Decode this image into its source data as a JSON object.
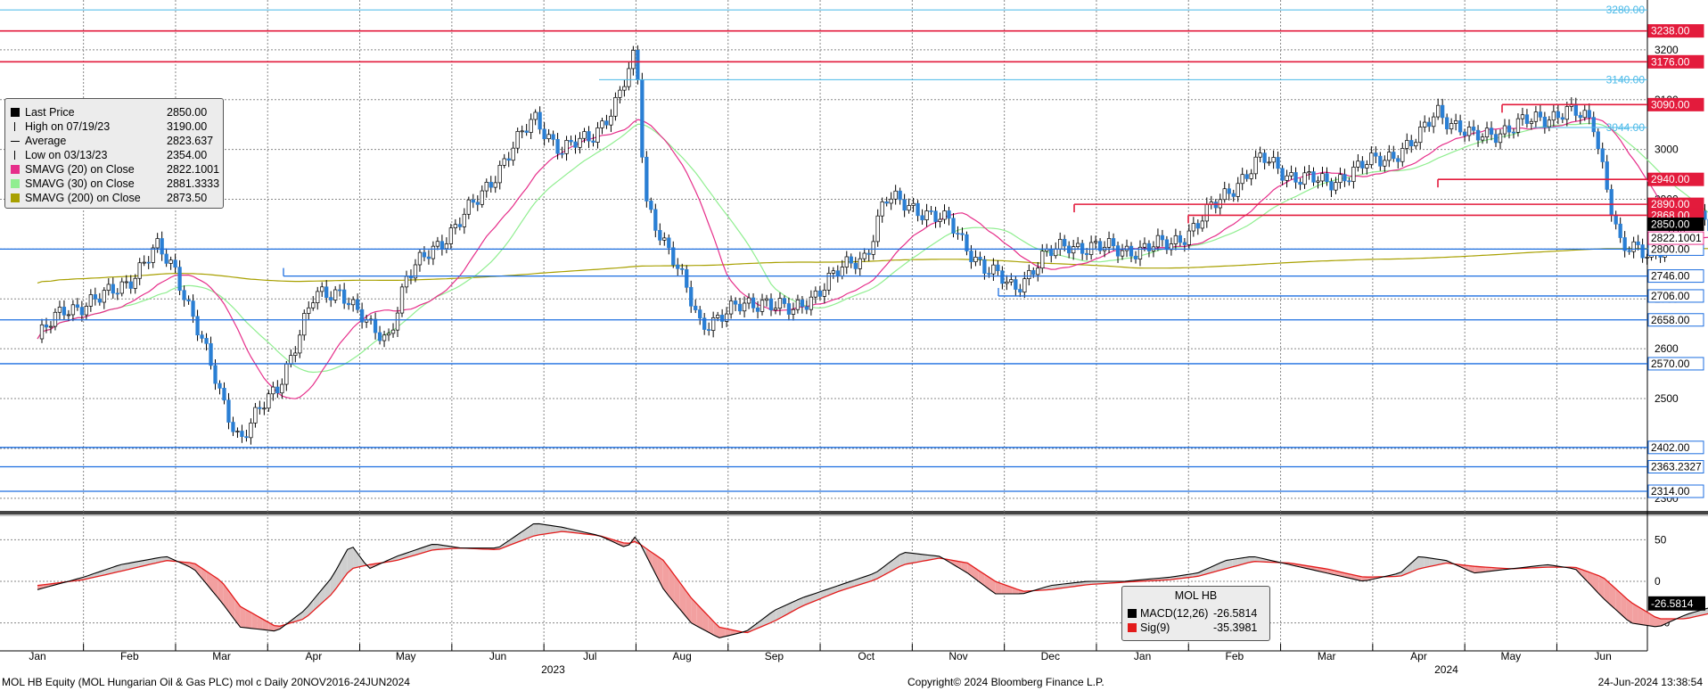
{
  "chart_data": [
    {
      "type": "candlestick",
      "title": "",
      "ylim": [
        2280,
        3300
      ],
      "y_ticks": [
        2300,
        2400,
        2500,
        2600,
        2700,
        2800,
        2900,
        3000,
        3100,
        3200
      ],
      "grid": true,
      "x_labels": [
        "Jan",
        "Feb",
        "Mar",
        "Apr",
        "May",
        "Jun",
        "Jul",
        "Aug",
        "Sep",
        "Oct",
        "Nov",
        "Dec",
        "Jan",
        "Feb",
        "Mar",
        "Apr",
        "May",
        "Jun"
      ],
      "year_labels": [
        "2023",
        "2024"
      ],
      "price_path": [
        [
          0,
          2620
        ],
        [
          0.3,
          2680
        ],
        [
          0.7,
          2700
        ],
        [
          1.0,
          2740
        ],
        [
          1.3,
          2800
        ],
        [
          1.5,
          2760
        ],
        [
          1.7,
          2660
        ],
        [
          2.0,
          2500
        ],
        [
          2.2,
          2420
        ],
        [
          2.6,
          2520
        ],
        [
          3.0,
          2700
        ],
        [
          3.3,
          2720
        ],
        [
          3.6,
          2640
        ],
        [
          3.8,
          2620
        ],
        [
          4.0,
          2740
        ],
        [
          4.4,
          2820
        ],
        [
          4.8,
          2900
        ],
        [
          5.1,
          2990
        ],
        [
          5.4,
          3060
        ],
        [
          5.7,
          3000
        ],
        [
          6.0,
          3020
        ],
        [
          6.3,
          3100
        ],
        [
          6.5,
          3190
        ],
        [
          6.6,
          2900
        ],
        [
          6.9,
          2780
        ],
        [
          7.2,
          2650
        ],
        [
          7.6,
          2680
        ],
        [
          7.9,
          2700
        ],
        [
          8.2,
          2670
        ],
        [
          8.6,
          2740
        ],
        [
          9.0,
          2790
        ],
        [
          9.2,
          2900
        ],
        [
          9.6,
          2880
        ],
        [
          9.9,
          2850
        ],
        [
          10.3,
          2760
        ],
        [
          10.6,
          2720
        ],
        [
          10.9,
          2780
        ],
        [
          11.2,
          2810
        ],
        [
          11.6,
          2800
        ],
        [
          12.0,
          2800
        ],
        [
          12.3,
          2810
        ],
        [
          12.6,
          2850
        ],
        [
          13.0,
          2930
        ],
        [
          13.3,
          2980
        ],
        [
          13.6,
          2950
        ],
        [
          14.0,
          2930
        ],
        [
          14.3,
          2960
        ],
        [
          14.6,
          2980
        ],
        [
          15.0,
          3020
        ],
        [
          15.2,
          3080
        ],
        [
          15.6,
          3020
        ],
        [
          15.9,
          3040
        ],
        [
          16.3,
          3060
        ],
        [
          16.6,
          3080
        ],
        [
          16.9,
          3050
        ],
        [
          17.2,
          2800
        ],
        [
          17.5,
          2790
        ],
        [
          17.8,
          2830
        ],
        [
          18.0,
          2870
        ],
        [
          18.3,
          2850
        ]
      ],
      "legend": [
        {
          "label": "Last Price",
          "value": "2850.00",
          "color": "#000000",
          "marker": "box"
        },
        {
          "label": "High on 07/19/23",
          "value": "3190.00",
          "color": "#000000",
          "marker": "high"
        },
        {
          "label": "Average",
          "value": "2823.637",
          "color": "#000000",
          "marker": "avg"
        },
        {
          "label": "Low on 03/13/23",
          "value": "2354.00",
          "color": "#000000",
          "marker": "low"
        },
        {
          "label": "SMAVG (20)  on Close",
          "value": "2822.1001",
          "color": "#e62e8a",
          "marker": "box"
        },
        {
          "label": "SMAVG (30)  on Close",
          "value": "2881.3333",
          "color": "#90ee90",
          "marker": "box"
        },
        {
          "label": "SMAVG (200)  on Close",
          "value": "2873.50",
          "color": "#a8a000",
          "marker": "box"
        }
      ],
      "levels_red": [
        {
          "value": 3238,
          "label": "3238.00"
        },
        {
          "value": 3176,
          "label": "3176.00"
        },
        {
          "value": 3090,
          "label": "3090.00"
        },
        {
          "value": 2940,
          "label": "2940.00"
        },
        {
          "value": 2890,
          "label": "2890.00"
        },
        {
          "value": 2868,
          "label": "2868.00"
        }
      ],
      "levels_blue": [
        {
          "value": 2800,
          "label": "2800.00"
        },
        {
          "value": 2746,
          "label": "2746.00"
        },
        {
          "value": 2706,
          "label": "2706.00"
        },
        {
          "value": 2658,
          "label": "2658.00"
        },
        {
          "value": 2570,
          "label": "2570.00"
        },
        {
          "value": 2402,
          "label": "2402.00"
        },
        {
          "value": 2363.2327,
          "label": "2363.2327"
        },
        {
          "value": 2314,
          "label": "2314.00"
        }
      ],
      "levels_lightblue": [
        {
          "value": 3280,
          "label": "3280.00"
        },
        {
          "value": 3140,
          "label": "3140.00"
        },
        {
          "value": 3044,
          "label": "3044.00"
        }
      ],
      "current_labels": [
        {
          "value": 2850,
          "label": "2850.00"
        },
        {
          "value": 2822.1001,
          "label": "2822.1001"
        }
      ]
    },
    {
      "type": "line",
      "title": "MOL HB",
      "ylim": [
        -75,
        75
      ],
      "y_ticks": [
        -50,
        0,
        50
      ],
      "series": [
        {
          "name": "MACD(12,26)",
          "value": "-26.5814",
          "color": "#000000"
        },
        {
          "name": "Sig(9)",
          "value": "-35.3981",
          "color": "#e31b1b"
        }
      ],
      "macd_path": [
        [
          0,
          -10
        ],
        [
          0.5,
          5
        ],
        [
          0.9,
          20
        ],
        [
          1.4,
          30
        ],
        [
          1.7,
          15
        ],
        [
          2.0,
          -25
        ],
        [
          2.2,
          -55
        ],
        [
          2.6,
          -60
        ],
        [
          2.9,
          -35
        ],
        [
          3.2,
          5
        ],
        [
          3.4,
          45
        ],
        [
          3.6,
          15
        ],
        [
          3.9,
          30
        ],
        [
          4.3,
          45
        ],
        [
          4.6,
          40
        ],
        [
          5.0,
          40
        ],
        [
          5.4,
          70
        ],
        [
          5.7,
          65
        ],
        [
          6.1,
          55
        ],
        [
          6.4,
          40
        ],
        [
          6.5,
          55
        ],
        [
          6.8,
          -10
        ],
        [
          7.1,
          -50
        ],
        [
          7.4,
          -68
        ],
        [
          7.7,
          -60
        ],
        [
          8.0,
          -35
        ],
        [
          8.3,
          -20
        ],
        [
          8.7,
          -5
        ],
        [
          9.1,
          10
        ],
        [
          9.4,
          35
        ],
        [
          9.8,
          30
        ],
        [
          10.1,
          10
        ],
        [
          10.4,
          -15
        ],
        [
          10.7,
          -15
        ],
        [
          11.0,
          -5
        ],
        [
          11.4,
          0
        ],
        [
          11.8,
          0
        ],
        [
          12.3,
          5
        ],
        [
          12.6,
          10
        ],
        [
          12.9,
          25
        ],
        [
          13.2,
          30
        ],
        [
          13.6,
          20
        ],
        [
          14.0,
          10
        ],
        [
          14.4,
          0
        ],
        [
          14.8,
          10
        ],
        [
          15.0,
          30
        ],
        [
          15.3,
          25
        ],
        [
          15.6,
          10
        ],
        [
          16.0,
          15
        ],
        [
          16.4,
          20
        ],
        [
          16.7,
          15
        ],
        [
          17.0,
          -20
        ],
        [
          17.3,
          -50
        ],
        [
          17.6,
          -55
        ],
        [
          17.9,
          -40
        ],
        [
          18.3,
          -27
        ]
      ],
      "signal_path": [
        [
          0,
          -5
        ],
        [
          0.5,
          2
        ],
        [
          0.9,
          12
        ],
        [
          1.4,
          25
        ],
        [
          1.7,
          22
        ],
        [
          2.0,
          0
        ],
        [
          2.2,
          -30
        ],
        [
          2.6,
          -55
        ],
        [
          2.9,
          -45
        ],
        [
          3.2,
          -15
        ],
        [
          3.4,
          15
        ],
        [
          3.6,
          20
        ],
        [
          3.9,
          25
        ],
        [
          4.3,
          38
        ],
        [
          4.6,
          40
        ],
        [
          5.0,
          38
        ],
        [
          5.4,
          55
        ],
        [
          5.7,
          60
        ],
        [
          6.1,
          55
        ],
        [
          6.4,
          45
        ],
        [
          6.5,
          48
        ],
        [
          6.8,
          25
        ],
        [
          7.1,
          -20
        ],
        [
          7.4,
          -55
        ],
        [
          7.7,
          -62
        ],
        [
          8.0,
          -48
        ],
        [
          8.3,
          -30
        ],
        [
          8.7,
          -12
        ],
        [
          9.1,
          2
        ],
        [
          9.4,
          20
        ],
        [
          9.8,
          28
        ],
        [
          10.1,
          22
        ],
        [
          10.4,
          0
        ],
        [
          10.7,
          -12
        ],
        [
          11.0,
          -10
        ],
        [
          11.4,
          -4
        ],
        [
          11.8,
          -1
        ],
        [
          12.3,
          2
        ],
        [
          12.6,
          6
        ],
        [
          12.9,
          15
        ],
        [
          13.2,
          24
        ],
        [
          13.6,
          22
        ],
        [
          14.0,
          15
        ],
        [
          14.4,
          5
        ],
        [
          14.8,
          6
        ],
        [
          15.0,
          15
        ],
        [
          15.3,
          22
        ],
        [
          15.6,
          18
        ],
        [
          16.0,
          15
        ],
        [
          16.4,
          17
        ],
        [
          16.7,
          17
        ],
        [
          17.0,
          5
        ],
        [
          17.3,
          -25
        ],
        [
          17.6,
          -45
        ],
        [
          17.9,
          -45
        ],
        [
          18.3,
          -35
        ]
      ],
      "current_labels": [
        {
          "value": -26.5814,
          "label": "-26.5814"
        }
      ]
    }
  ],
  "footer": {
    "left": "MOL HB Equity (MOL Hungarian Oil & Gas PLC) mol c  Daily 20NOV2016-24JUN2024",
    "center": "Copyright© 2024 Bloomberg Finance L.P.",
    "right": "24-Jun-2024 13:38:54"
  }
}
